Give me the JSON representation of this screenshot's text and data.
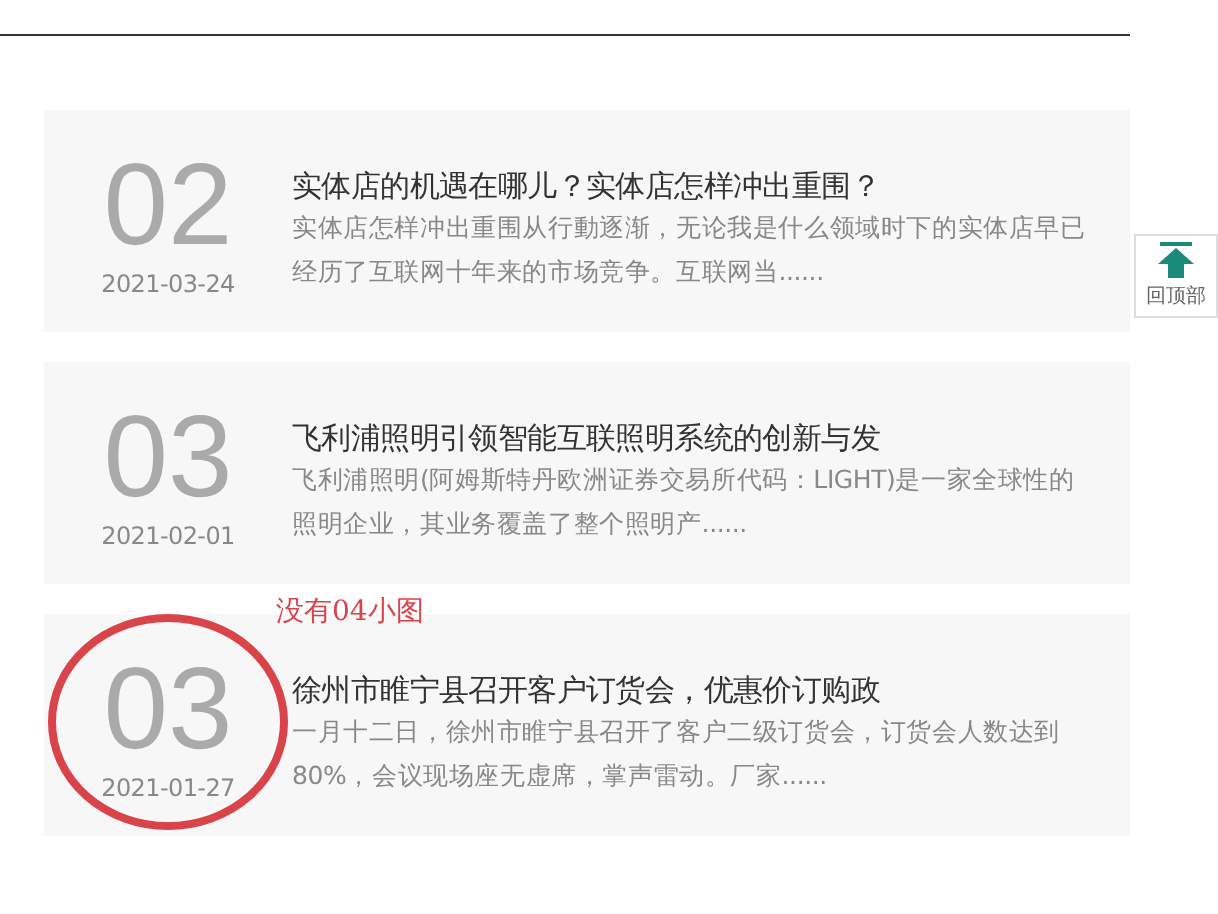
{
  "articles": [
    {
      "number": "02",
      "date": "2021-03-24",
      "title": "实体店的机遇在哪儿？实体店怎样冲出重围？",
      "summary": "实体店怎样冲出重围从行動逐渐，无论我是什么领域时下的实体店早已经历了互联网十年来的市场竞争。互联网当......",
      "circled": false
    },
    {
      "number": "03",
      "date": "2021-02-01",
      "title": "飞利浦照明引领智能互联照明系统的创新与发",
      "summary": "飞利浦照明(阿姆斯特丹欧洲证券交易所代码：LIGHT)是一家全球性的照明企业，其业务覆盖了整个照明产......",
      "circled": false
    },
    {
      "number": "03",
      "date": "2021-01-27",
      "title": "徐州市睢宁县召开客户订货会，优惠价订购政",
      "summary": "一月十二日，徐州市睢宁县召开了客户二级订货会，订货会人数达到80%，会议现场座无虚席，掌声雷动。厂家......",
      "circled": true,
      "note": "没有04小图"
    }
  ],
  "back_to_top": {
    "label": "回顶部"
  }
}
